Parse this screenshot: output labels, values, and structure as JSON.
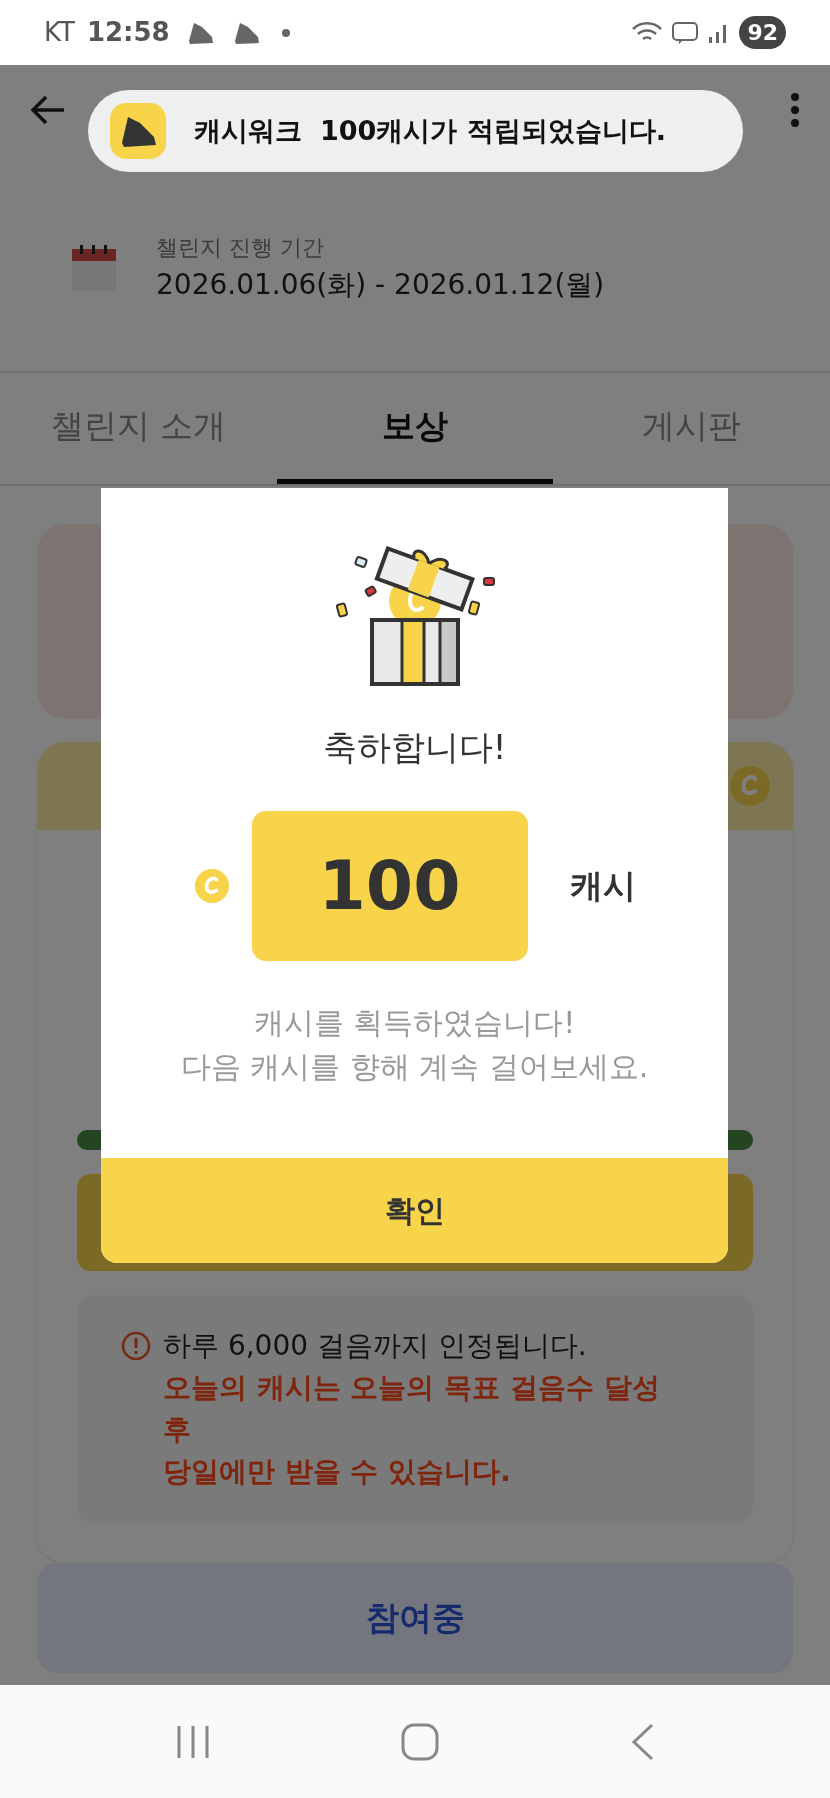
{
  "status_bar": {
    "carrier": "KT",
    "time": "12:58",
    "battery": "92"
  },
  "toast": {
    "app_name": "캐시워크",
    "message": "100캐시가 적립되었습니다."
  },
  "challenge_period": {
    "label": "챌린지 진행 기간",
    "value": "2026.01.06(화) - 2026.01.12(월)"
  },
  "tabs": [
    {
      "label": "챌린지 소개",
      "selected": false
    },
    {
      "label": "보상",
      "selected": true
    },
    {
      "label": "게시판",
      "selected": false
    }
  ],
  "notice": {
    "text": "하루 6,000 걸음까지 인정됩니다.",
    "warning": [
      "오늘의 캐시는 오늘의 목표 걸음수 달성",
      "후",
      "당일에만 받을 수 있습니다."
    ]
  },
  "join_button": "참여중",
  "dialog": {
    "title": "축하합니다!",
    "amount": "100",
    "unit": "캐시",
    "message": [
      "캐시를 획득하였습니다!",
      "다음 캐시를 향해 계속 걸어보세요."
    ],
    "confirm": "확인"
  }
}
